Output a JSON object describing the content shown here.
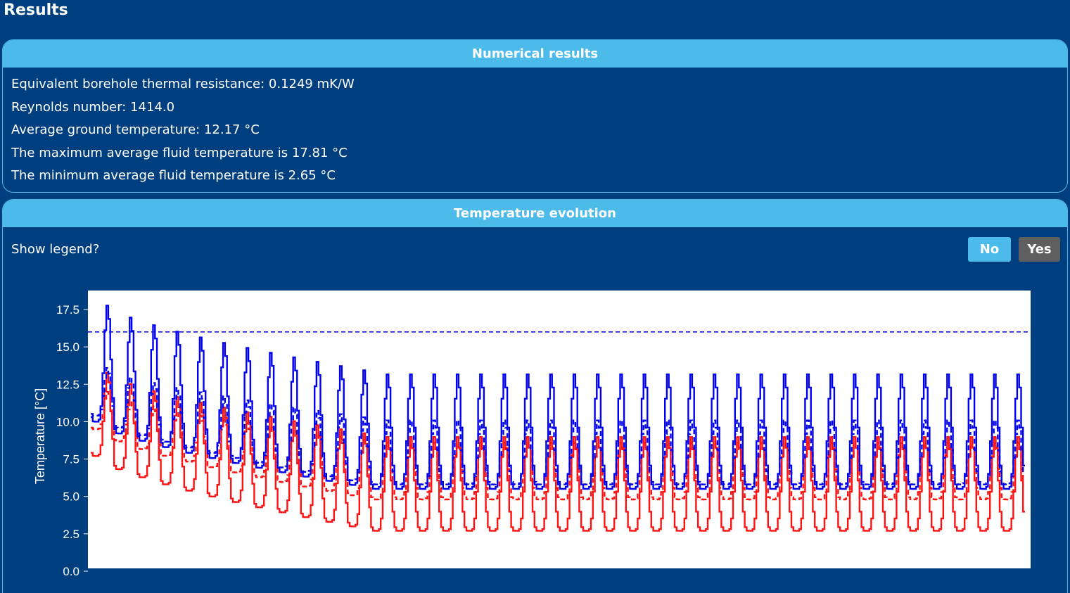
{
  "page": {
    "title": "Results"
  },
  "numerical": {
    "header": "Numerical results",
    "lines": [
      "Equivalent borehole thermal resistance: 0.1249 mK/W",
      "Reynolds number: 1414.0",
      "Average ground temperature: 12.17 °C",
      "The maximum average fluid temperature is 17.81 °C",
      "The minimum average fluid temperature is 2.65 °C"
    ]
  },
  "temperature": {
    "header": "Temperature evolution",
    "legend_question": "Show legend?",
    "buttons": {
      "no": "No",
      "yes": "Yes"
    }
  },
  "chart_data": {
    "type": "line",
    "ylabel": "Temperature [°C]",
    "ylim": [
      0.0,
      18.5
    ],
    "yticks": [
      "0.0",
      "2.5",
      "5.0",
      "7.5",
      "10.0",
      "12.5",
      "15.0",
      "17.5"
    ],
    "years": 40,
    "colors": {
      "upper": "#0000ee",
      "lower": "#ff1111",
      "limit": "#0000ee"
    },
    "limit_line": 16.0,
    "series": [
      {
        "style": "solid-upper",
        "peaks_first": 17.8,
        "peaks_late": 13.2,
        "troughs_first": 10.0,
        "troughs_late": 5.5
      },
      {
        "style": "dashed-upper",
        "peaks_first": 13.6,
        "peaks_late": 10.1,
        "troughs_first": 10.4,
        "troughs_late": 5.8
      },
      {
        "style": "solid-lower",
        "peaks_first": 13.3,
        "peaks_late": 9.0,
        "troughs_first": 7.7,
        "troughs_late": 2.7
      },
      {
        "style": "dashed-lower",
        "peaks_first": 12.0,
        "peaks_late": 8.6,
        "troughs_first": 9.5,
        "troughs_late": 4.8
      }
    ]
  }
}
